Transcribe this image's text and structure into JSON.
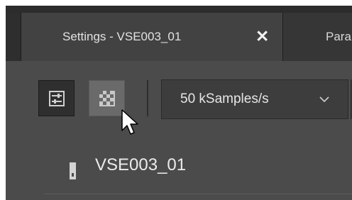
{
  "tabs": [
    {
      "label": "Settings - VSE003_01",
      "close": "✕",
      "active": true
    },
    {
      "label": "Para",
      "active": false
    }
  ],
  "toolbar": {
    "buttons": [
      {
        "icon": "sliders-icon",
        "active": true
      },
      {
        "icon": "checker-pattern-icon",
        "hovered": true
      }
    ],
    "sample_rate_select": {
      "value": "50 kSamples/s",
      "icon": "chevron-down-icon"
    }
  },
  "device": {
    "icon": "device-icon",
    "name": "VSE003_01"
  },
  "colors": {
    "panel_bg": "#4b4b4b",
    "tab_active_bg": "#424242",
    "tab_bar_bg": "#353535",
    "text": "#e6e6e6"
  }
}
